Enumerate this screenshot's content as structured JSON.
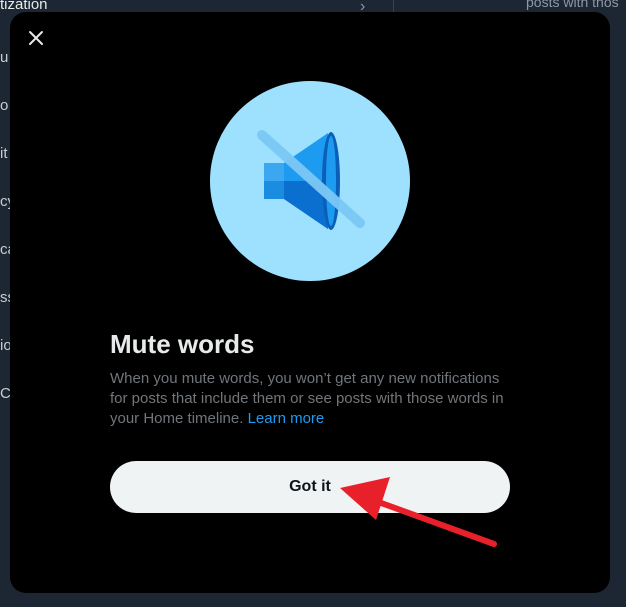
{
  "background": {
    "first_item": "tization",
    "items": [
      "u",
      "o",
      "it",
      "cy",
      "ca",
      "ss",
      "io",
      "Co"
    ],
    "top_right_text": "posts with thos"
  },
  "modal": {
    "close_icon": "close-icon",
    "illustration_icon": "muted-speaker-icon",
    "title": "Mute words",
    "body": "When you mute words, you won’t get any new notifications for posts that include them or see posts with those words in your Home timeline.",
    "learn_more": "Learn more",
    "got_it_label": "Got it"
  },
  "annotation": {
    "color": "#e8202a"
  },
  "colors": {
    "modal_bg": "#000000",
    "accent": "#1d9bf0",
    "button_bg": "#eff3f4",
    "circle": "#9ee1ff"
  }
}
